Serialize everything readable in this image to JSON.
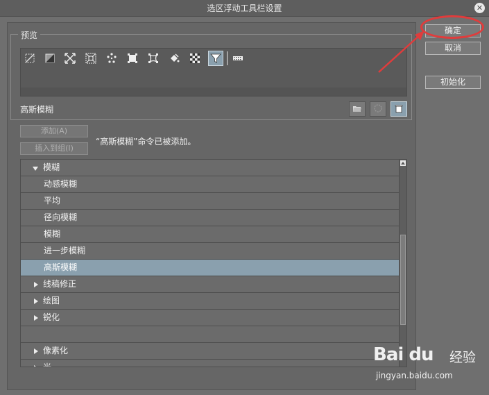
{
  "window": {
    "title": "选区浮动工具栏设置",
    "close_glyph": "✕"
  },
  "preview": {
    "legend": "预览",
    "tools": [
      {
        "icon": "deselect-icon"
      },
      {
        "icon": "invert-selection-icon"
      },
      {
        "icon": "expand-selection-icon"
      },
      {
        "icon": "shrink-selection-icon"
      },
      {
        "icon": "dots-selection-icon"
      },
      {
        "icon": "scale-selection-icon"
      },
      {
        "icon": "transform-icon"
      },
      {
        "icon": "fill-bucket-icon"
      },
      {
        "icon": "checker-icon"
      },
      {
        "icon": "filter-icon",
        "active": true
      },
      {
        "icon": "film-strip-icon"
      }
    ]
  },
  "selected_command": {
    "name": "高斯模糊"
  },
  "actions": {
    "add_label": "添加(A)",
    "insert_group_label": "插入到组(I)",
    "status": "“高斯模糊”命令已被添加。"
  },
  "tree": {
    "items": [
      {
        "label": "模糊",
        "type": "parent",
        "expanded": true
      },
      {
        "label": "动感模糊",
        "type": "child"
      },
      {
        "label": "平均",
        "type": "child"
      },
      {
        "label": "径向模糊",
        "type": "child"
      },
      {
        "label": "模糊",
        "type": "child"
      },
      {
        "label": "进一步模糊",
        "type": "child"
      },
      {
        "label": "高斯模糊",
        "type": "child",
        "selected": true
      },
      {
        "label": "线稿修正",
        "type": "parent",
        "expanded": false
      },
      {
        "label": "绘图",
        "type": "parent",
        "expanded": false
      },
      {
        "label": "锐化",
        "type": "parent",
        "expanded": false
      },
      {
        "label": "",
        "type": "blank"
      },
      {
        "label": "像素化",
        "type": "parent",
        "expanded": false
      },
      {
        "label": "光",
        "type": "parent",
        "expanded": false
      }
    ]
  },
  "buttons": {
    "ok": "确定",
    "cancel": "取消",
    "reset": "初始化"
  },
  "watermark": {
    "brand": "Bai du",
    "sub": "经验",
    "url": "jingyan.baidu.com"
  },
  "colors": {
    "annotation": "#e03c3c",
    "selection": "#8aa0ae"
  }
}
